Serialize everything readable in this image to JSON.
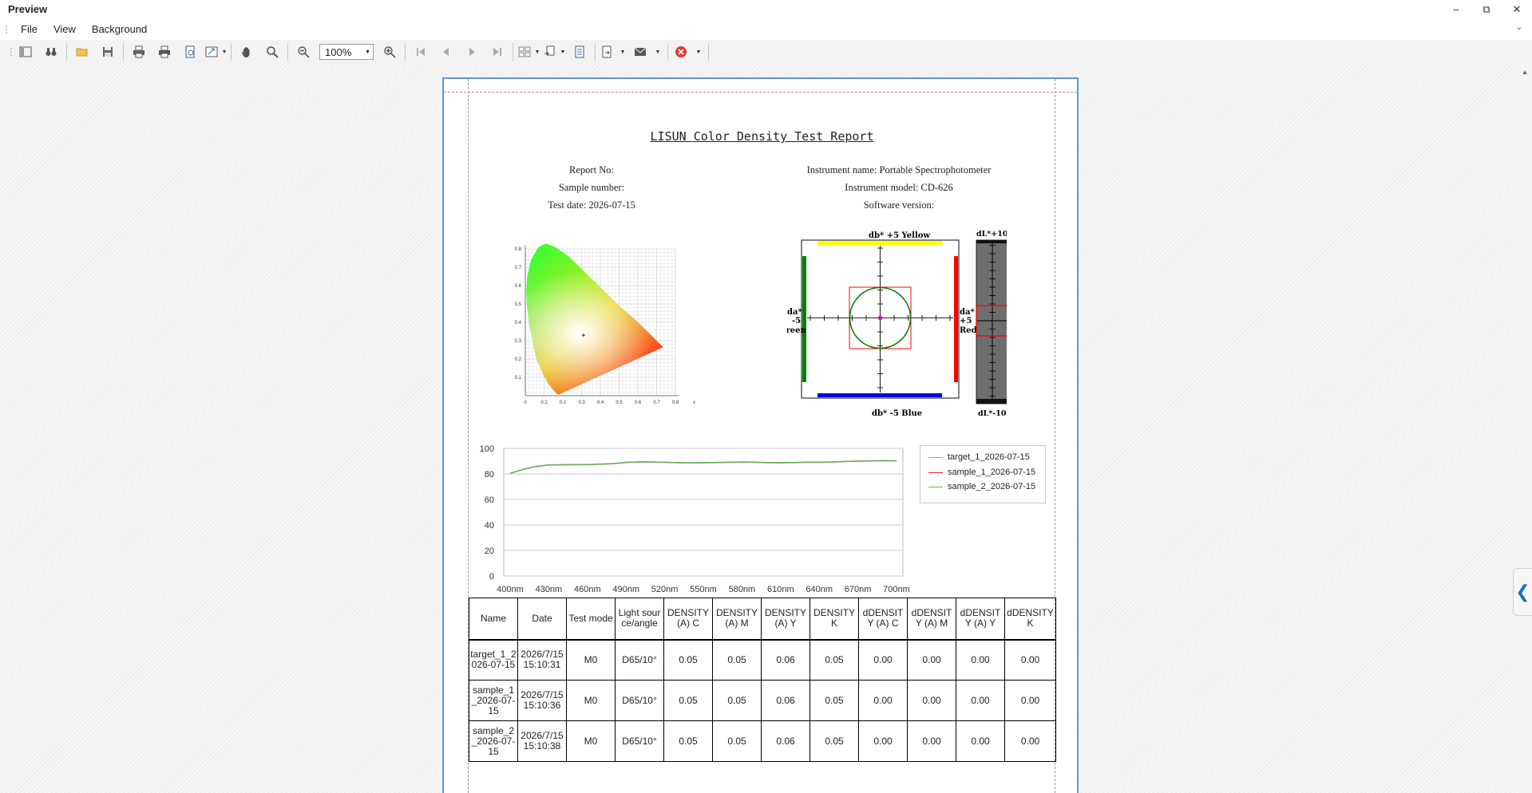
{
  "window": {
    "title": "Preview"
  },
  "menu": [
    "File",
    "View",
    "Background"
  ],
  "toolbar": {
    "zoom": "100%"
  },
  "report": {
    "title": "LISUN Color Density Test Report",
    "left_meta": [
      "Report No:",
      "Sample number:",
      "Test date: 2026-07-15"
    ],
    "right_meta": [
      "Instrument name: Portable Spectrophotometer",
      "Instrument model: CD-626",
      "Software version:"
    ]
  },
  "cie_chart": {
    "y_ticks": [
      "0.8",
      "0.7",
      "0.6",
      "0.5",
      "0.4",
      "0.3",
      "0.2",
      "0.1"
    ],
    "x_ticks": [
      "0",
      "0.1",
      "0.2",
      "0.3",
      "0.4",
      "0.5",
      "0.6",
      "0.7",
      "0.8",
      "x"
    ],
    "point": {
      "x": 0.31,
      "y": 0.33
    }
  },
  "lab_box": {
    "top_label": "db* +5 Yellow",
    "bottom_label": "db* -5 Blue",
    "left_label": [
      "da*",
      "-5",
      "Green"
    ],
    "right_label": [
      "da*",
      "+5",
      "Red"
    ],
    "dl_top": "dL*+10",
    "dl_bottom": "dL*-10",
    "dl_zero": "0",
    "colors": {
      "yellow": "#ffff00",
      "blue": "#0000dd",
      "green": "#008000",
      "red": "#ff0000",
      "marker": "#cc00cc"
    }
  },
  "chart_data": {
    "type": "line",
    "x": [
      "400nm",
      "410nm",
      "420nm",
      "430nm",
      "440nm",
      "450nm",
      "460nm",
      "470nm",
      "480nm",
      "490nm",
      "500nm",
      "510nm",
      "520nm",
      "530nm",
      "540nm",
      "550nm",
      "560nm",
      "570nm",
      "580nm",
      "590nm",
      "600nm",
      "610nm",
      "620nm",
      "630nm",
      "640nm",
      "650nm",
      "660nm",
      "670nm",
      "680nm",
      "690nm",
      "700nm"
    ],
    "x_tick_labels": [
      "400nm",
      "430nm",
      "460nm",
      "490nm",
      "520nm",
      "550nm",
      "580nm",
      "610nm",
      "640nm",
      "670nm",
      "700nm"
    ],
    "y_tick_labels": [
      "100",
      "80",
      "60",
      "40",
      "20",
      "0"
    ],
    "ylim": [
      0,
      100
    ],
    "grid": true,
    "legend_position": "right",
    "series": [
      {
        "name": "target_1_2026-07-15",
        "color": "#5bb8d8",
        "values": [
          80.5,
          83.6,
          85.9,
          87.1,
          87.2,
          87.3,
          87.4,
          87.7,
          88.1,
          89.1,
          89.5,
          89.4,
          89.2,
          88.9,
          88.7,
          88.8,
          89.0,
          89.2,
          89.4,
          89.2,
          88.9,
          88.8,
          89.0,
          89.2,
          89.2,
          89.4,
          89.8,
          90.1,
          90.3,
          90.4,
          90.3
        ]
      },
      {
        "name": "sample_1_2026-07-15",
        "color": "#e03030",
        "values": [
          80.4,
          83.5,
          85.8,
          87.0,
          87.1,
          87.2,
          87.3,
          87.6,
          88.0,
          89.0,
          89.4,
          89.3,
          89.1,
          88.8,
          88.6,
          88.7,
          88.9,
          89.1,
          89.3,
          89.1,
          88.8,
          88.7,
          88.9,
          89.1,
          89.1,
          89.3,
          89.7,
          90.0,
          90.2,
          90.3,
          90.2
        ]
      },
      {
        "name": "sample_2_2026-07-15",
        "color": "#6aae5a",
        "values": [
          80.4,
          83.5,
          85.8,
          87.0,
          87.1,
          87.2,
          87.3,
          87.6,
          88.0,
          89.0,
          89.4,
          89.3,
          89.1,
          88.8,
          88.6,
          88.7,
          88.9,
          89.1,
          89.3,
          89.1,
          88.8,
          88.7,
          88.9,
          89.1,
          89.1,
          89.3,
          89.7,
          90.0,
          90.2,
          90.3,
          90.2
        ]
      }
    ]
  },
  "table": {
    "headers": [
      "Name",
      "Date",
      "Test mode",
      "Light source/angle",
      "DENSITY (A) C",
      "DENSITY (A) M",
      "DENSITY (A) Y",
      "DENSITY K",
      "dDENSITY (A) C",
      "dDENSITY (A) M",
      "dDENSITY (A) Y",
      "dDENSITY K"
    ],
    "rows": [
      [
        "target_1_2026-07-15",
        "2026/7/15 15:10:31",
        "M0",
        "D65/10°",
        "0.05",
        "0.05",
        "0.06",
        "0.05",
        "0.00",
        "0.00",
        "0.00",
        "0.00"
      ],
      [
        "sample_1_2026-07-15",
        "2026/7/15 15:10:36",
        "M0",
        "D65/10°",
        "0.05",
        "0.05",
        "0.06",
        "0.05",
        "0.00",
        "0.00",
        "0.00",
        "0.00"
      ],
      [
        "sample_2_2026-07-15",
        "2026/7/15 15:10:38",
        "M0",
        "D65/10°",
        "0.05",
        "0.05",
        "0.06",
        "0.05",
        "0.00",
        "0.00",
        "0.00",
        "0.00"
      ]
    ]
  }
}
